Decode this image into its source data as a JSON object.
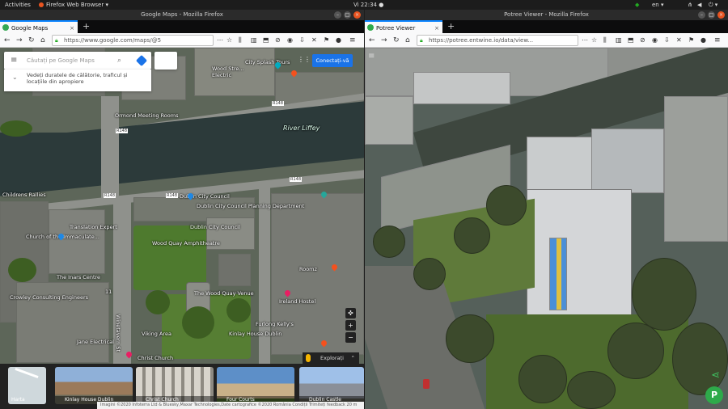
{
  "topbar": {
    "activities": "Activities",
    "app": "Firefox Web Browser ▾",
    "clock": "Vi 22:34 ●",
    "lang": "en ▾"
  },
  "left_window": {
    "title": "Google Maps - Mozilla Firefox",
    "tab_label": "Google Maps",
    "url": "https://www.google.com/maps/@5",
    "search_placeholder": "Căutați pe Google Maps",
    "suggestion": "Vedeți duratele de călătorie, traficul și locațiile din apropiere",
    "signin": "Conectați-vă",
    "explore": "Explorați",
    "labels": {
      "city_splash": "City Splash Tours",
      "wood_street": "Wood Stre...",
      "electric": "Electric",
      "river": "River Liffey",
      "ormond": "Ormond Meeting Rooms",
      "r148a": "R148",
      "r148b": "R148",
      "r148c": "R148",
      "r148d": "R148",
      "r148e": "R148",
      "childrens": "Childrens Rallies",
      "dublin_council": "Dublin City Council",
      "dublin_council_full": "Dublin City Council Planning Department",
      "dublin_council2": "Dublin City Council",
      "translation": "Translation Expert",
      "church": "Church of the Immaculate...",
      "wood_quay": "Wood Quay Amphitheatre",
      "wood_quay_venue": "The Wood Quay Venue",
      "ireland_hostel": "Ireland Hostel",
      "crowley": "Crowley Consulting Engineers",
      "winetavern": "Winetavern St",
      "viking": "Viking Area",
      "kinlay": "Kinlay House Dublin",
      "christ_church": "Christ Church",
      "furlong": "Furlong Kelly's",
      "jane": "Jane Electrical",
      "eleven": "11",
      "roomz": "Roomz",
      "the_inars": "The Inars Centre"
    },
    "thumbs": [
      {
        "caption": "Harta"
      },
      {
        "caption": "Kinlay House Dublin"
      },
      {
        "caption": "Christ Church"
      },
      {
        "caption": "Four Courts"
      },
      {
        "caption": "Dublin Castle"
      }
    ],
    "footer": "Imagini ©2020 Infoterra Ltd & Bluesky,Maxar Technologies,Date cartografice ©2020   România   Condiții   Trimiteți feedback   20 m"
  },
  "right_window": {
    "title": "Potree Viewer - Mozilla Firefox",
    "tab_label": "Potree Viewer",
    "url": "https://potree.entwine.io/data/view..."
  },
  "colors": {
    "accent": "#1a73e8",
    "ubuntu_close": "#e95420",
    "potree_green": "#2eaa4a"
  }
}
